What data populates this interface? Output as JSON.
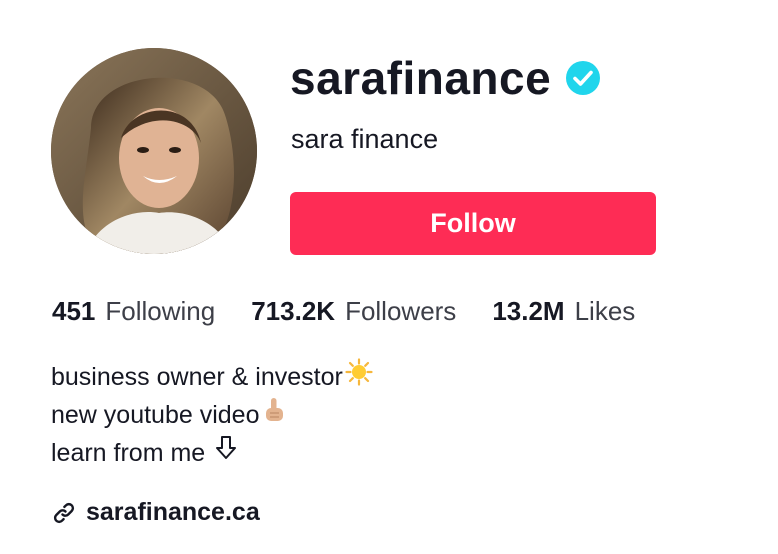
{
  "profile": {
    "username": "sarafinance",
    "verified": true,
    "display_name": "sara finance",
    "follow_label": "Follow",
    "brand_color": "#fe2c55",
    "verified_color": "#20d5ec"
  },
  "stats": [
    {
      "value": "451",
      "label": "Following"
    },
    {
      "value": "713.2K",
      "label": "Followers"
    },
    {
      "value": "13.2M",
      "label": "Likes"
    }
  ],
  "bio": {
    "lines": [
      {
        "text": "business owner & investor",
        "icon": "sun-emoji"
      },
      {
        "text": "new youtube video",
        "icon": "pointing-up-emoji"
      },
      {
        "text": "learn from me",
        "icon": "down-arrow-icon"
      }
    ]
  },
  "link": {
    "icon": "link-icon",
    "text": "sarafinance.ca"
  }
}
